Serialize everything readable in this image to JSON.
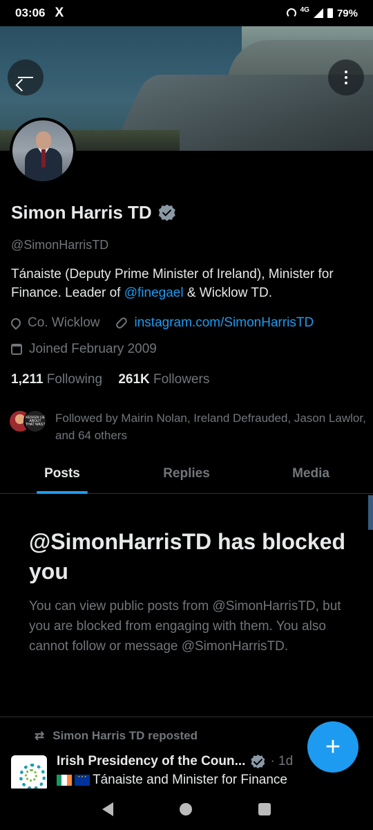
{
  "status_bar": {
    "time": "03:06",
    "app_icon": "X",
    "network": "4G",
    "battery": "79%"
  },
  "profile": {
    "name": "Simon Harris TD",
    "handle": "@SimonHarrisTD",
    "bio_pre": "Tánaiste (Deputy Prime Minister of Ireland), Minister for Finance. Leader of ",
    "bio_link": "@finegael",
    "bio_post": " & Wicklow TD.",
    "location": "Co. Wicklow",
    "website": "instagram.com/SimonHarrisTD",
    "joined": "Joined February 2009",
    "following_count": "1,211",
    "following_label": "Following",
    "followers_count": "261K",
    "followers_label": "Followers",
    "followed_by": "Followed by Mairin Nolan, Ireland Defrauded, Jason Lawlor, and 64 others",
    "followed_avatar_text": "RESIGN LIE ABOUT THAT WAS?"
  },
  "tabs": [
    {
      "label": "Posts",
      "active": true
    },
    {
      "label": "Replies",
      "active": false
    },
    {
      "label": "Media",
      "active": false
    }
  ],
  "blocked": {
    "title": "@SimonHarrisTD has blocked you",
    "body": "You can view public posts from @SimonHarrisTD, but you are blocked from engaging with them. You also cannot follow or message @SimonHarrisTD."
  },
  "post": {
    "repost_label": "Simon Harris TD reposted",
    "author": "Irish Presidency of the Coun...",
    "time": "· 1d",
    "text": "Tánaiste and Minister for Finance"
  },
  "colors": {
    "accent": "#1d9bf0",
    "muted": "#71767b",
    "text": "#e7e9ea",
    "background": "#000000"
  },
  "icons": [
    "back-arrow-icon",
    "more-vert-icon",
    "verified-badge-icon",
    "location-icon",
    "link-icon",
    "calendar-icon",
    "repost-icon",
    "compose-plus-icon"
  ]
}
